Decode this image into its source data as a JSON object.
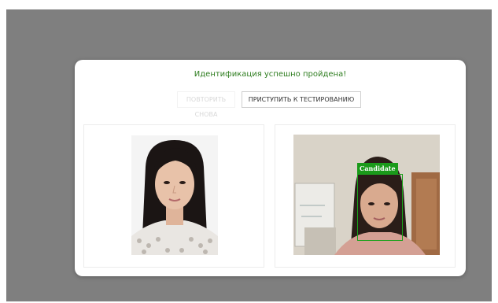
{
  "modal": {
    "title": "Идентификация успешно пройдена!",
    "retry_button": "ПОВТОРИТЬ СНОВА",
    "start_button": "ПРИСТУПИТЬ К ТЕСТИРОВАНИЮ"
  },
  "webcam": {
    "detection_label": "Candidate",
    "box_color": "#1aa11a"
  },
  "colors": {
    "success_text": "#2e7d1f",
    "overlay": "#7f7f7f"
  }
}
